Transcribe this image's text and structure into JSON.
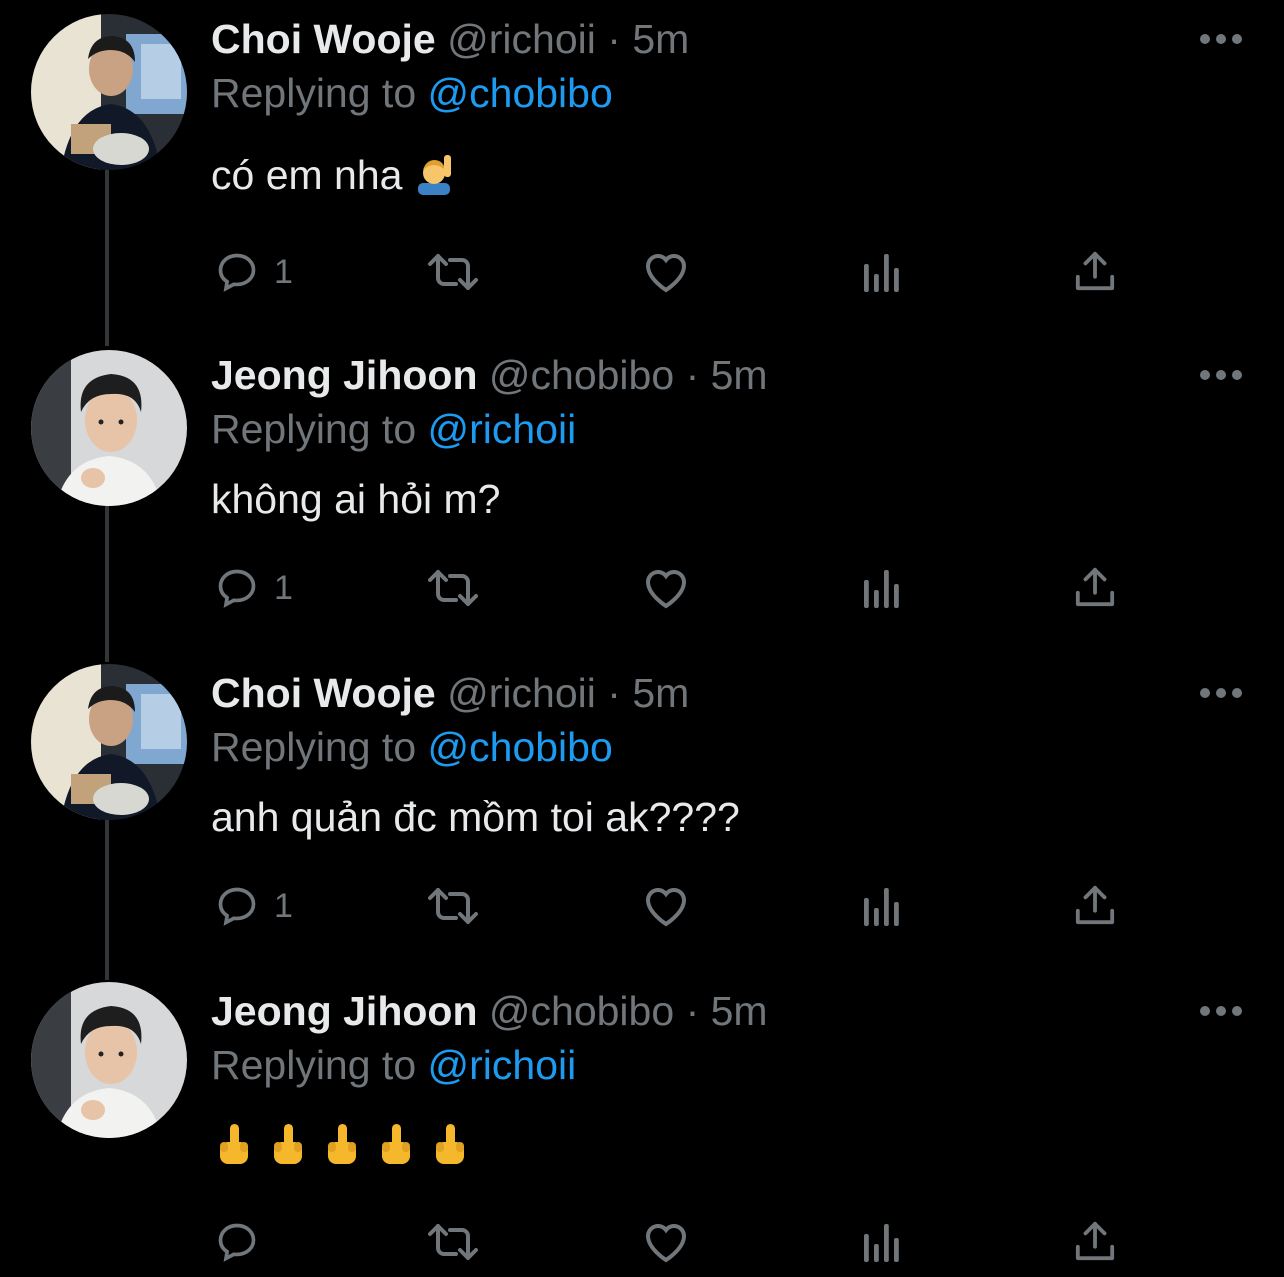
{
  "thread": [
    {
      "display_name": "Choi Wooje",
      "handle": "@richoii",
      "separator": "·",
      "time": "5m",
      "replying_label": "Replying to",
      "replying_to": "@chobibo",
      "text": "có em nha",
      "text_emoji": "person-raising-hand-emoji",
      "reply_count": "1",
      "avatar": "choi-wooje-avatar"
    },
    {
      "display_name": "Jeong Jihoon",
      "handle": "@chobibo",
      "separator": "·",
      "time": "5m",
      "replying_label": "Replying to",
      "replying_to": "@richoii",
      "text": "không ai hỏi m?",
      "reply_count": "1",
      "avatar": "jeong-jihoon-avatar"
    },
    {
      "display_name": "Choi Wooje",
      "handle": "@richoii",
      "separator": "·",
      "time": "5m",
      "replying_label": "Replying to",
      "replying_to": "@chobibo",
      "text": "anh quản đc mồm toi ak????",
      "reply_count": "1",
      "avatar": "choi-wooje-avatar"
    },
    {
      "display_name": "Jeong Jihoon",
      "handle": "@chobibo",
      "separator": "·",
      "time": "5m",
      "replying_label": "Replying to",
      "replying_to": "@richoii",
      "text_emojis": [
        "middle-finger-emoji",
        "middle-finger-emoji",
        "middle-finger-emoji",
        "middle-finger-emoji",
        "middle-finger-emoji"
      ],
      "reply_count": "",
      "avatar": "jeong-jihoon-avatar"
    }
  ],
  "colors": {
    "background": "#000000",
    "text": "#e7e9ea",
    "secondary": "#71767b",
    "link": "#1d9bf0",
    "thread_line": "#333639"
  },
  "icons": {
    "reply": "reply-icon",
    "retweet": "retweet-icon",
    "like": "heart-icon",
    "views": "analytics-icon",
    "share": "share-icon",
    "more": "more-icon"
  }
}
